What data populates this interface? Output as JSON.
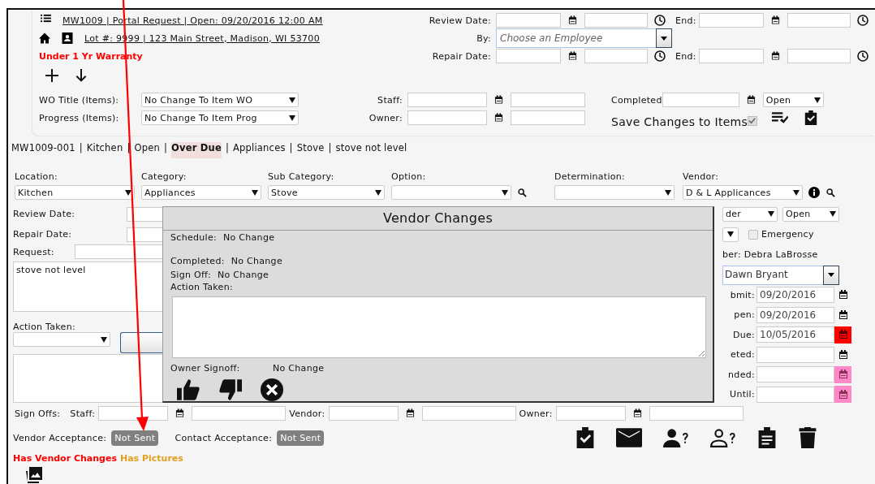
{
  "header": {
    "menu_link": "MW1009 | Portal Request | Open: 09/20/2016 12:00 AM",
    "address_link": "Lot #: 9999 | 123 Main Street, Madison, WI 53700",
    "warranty": "Under 1 Yr Warranty"
  },
  "schedule": [
    {
      "label": "Review Date:",
      "end_label": "End:"
    },
    {
      "label": "Repair Date:",
      "end_label": "End:"
    }
  ],
  "assignee": {
    "label": "By:",
    "placeholder": "Choose an Employee"
  },
  "bulk_edit": {
    "wo_title": {
      "label": "WO Title (Items):",
      "value": "No Change To Item WO"
    },
    "progress": {
      "label": "Progress (Items):",
      "value": "No Change To Item Prog"
    },
    "staff_label": "Staff:",
    "owner_label": "Owner:",
    "completed_label": "Completed",
    "status": "Open",
    "save": {
      "label": "Save Changes to Items",
      "checked": true
    }
  },
  "item": {
    "separator": "|",
    "summary": [
      {
        "text": "MW1009-001",
        "flagged": false
      },
      {
        "text": "Kitchen",
        "flagged": false
      },
      {
        "text": "Open",
        "flagged": false
      },
      {
        "text": "Over Due",
        "flagged": true
      },
      {
        "text": "Appliances",
        "flagged": false
      },
      {
        "text": "Stove",
        "flagged": false
      },
      {
        "text": "stove not level",
        "flagged": false
      }
    ]
  },
  "fields": [
    {
      "label": "Location:",
      "value": "Kitchen"
    },
    {
      "label": "Category:",
      "value": "Appliances"
    },
    {
      "label": "Sub Category:",
      "value": "Stove"
    },
    {
      "label": "Option:",
      "search": true
    },
    {
      "label": "Determination:"
    },
    {
      "label": "Vendor:",
      "value": "D & L Applicances",
      "info": true,
      "search": true
    }
  ],
  "left_panel": {
    "review_label": "Review Date:",
    "repair_label": "Repair Date:",
    "request_label": "Request:",
    "request_text": "stove not level",
    "action_label": "Action Taken:"
  },
  "right_panel": {
    "type_value": "der",
    "status_value": "Open",
    "emergency": {
      "label": "Emergency",
      "checked": false
    },
    "member": "ber: Debra LaBrosse",
    "assigned": "Dawn Bryant",
    "dates": [
      {
        "label": "bmit:",
        "value": "09/20/2016",
        "overdue": false,
        "reminder": false
      },
      {
        "label": "pen:",
        "value": "09/20/2016",
        "overdue": false,
        "reminder": false
      },
      {
        "label": "Due:",
        "value": "10/05/2016",
        "overdue": true,
        "reminder": false
      },
      {
        "label": "eted:",
        "overdue": false,
        "reminder": false
      },
      {
        "label": "nded:",
        "overdue": false,
        "reminder": true
      },
      {
        "label": "Until:",
        "overdue": false,
        "reminder": true
      }
    ]
  },
  "sign_offs": {
    "label": "Sign Offs:",
    "parties": [
      {
        "label": "Staff:"
      },
      {
        "label": "Vendor:"
      },
      {
        "label": "Owner:"
      }
    ]
  },
  "acceptance": [
    {
      "label": "Vendor Acceptance:",
      "status": "Not Sent"
    },
    {
      "label": "Contact Acceptance:",
      "status": "Not Sent"
    }
  ],
  "flags": [
    {
      "text": "Has Vendor Changes",
      "color": "#ff0000"
    },
    {
      "text": "Has Pictures",
      "color": "#e0a020"
    }
  ],
  "modal": {
    "title": "Vendor Changes",
    "rows": [
      {
        "label": "Schedule:",
        "value": "No Change"
      },
      {
        "label": "Completed:",
        "value": "No Change"
      },
      {
        "label": "Sign Off:",
        "value": "No Change"
      }
    ],
    "action_label": "Action Taken:",
    "owner_label": "Owner Signoff:",
    "owner_value": "No Change"
  }
}
